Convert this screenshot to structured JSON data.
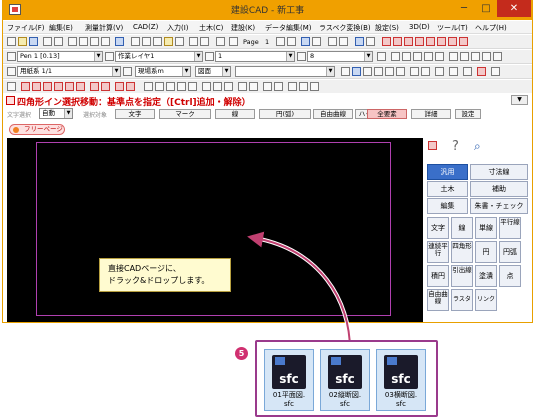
{
  "window": {
    "title": "建設CAD - 新工事",
    "min_label": "─",
    "max_label": "□",
    "close_label": "✕"
  },
  "menu": [
    "ファイル(F)",
    "編集(E)",
    "測量計算(V)",
    "CAD(Z)",
    "入力(I)",
    "土木(C)",
    "建設(K)",
    "データ編集(M)",
    "ラスベク変換(B)",
    "設定(S)",
    "3D(D)",
    "ツール(T)",
    "ヘルプ(H)"
  ],
  "toolbar1": {
    "page_label": "Page",
    "page_value": "1"
  },
  "toolbar2": {
    "pen_value": "Pen 1 [0.13]",
    "layer_value": "作業レイヤ1",
    "line_value": "1",
    "color_value": "8"
  },
  "toolbar3": {
    "paper_value": "用紙系 1/1",
    "coord_value": "現場系m",
    "view_value": "図面"
  },
  "command": {
    "text": "四角形イン選択移動：基準点を指定（[Ctrl]追加・解除）",
    "dropdown": "▼"
  },
  "options": {
    "label1": "文字選択",
    "auto_value": "自動",
    "label2": "選択対象",
    "buttons": [
      "文字",
      "マーク",
      "線",
      "円(弧)",
      "自由曲線",
      "ハッチング",
      "全要素",
      "詳細",
      "設定"
    ]
  },
  "page_tab": "フリーページ",
  "panel": {
    "row1": [
      "汎用",
      "寸法線"
    ],
    "row2": [
      "土木",
      "補助"
    ],
    "row3": [
      "編集",
      "朱書・チェック"
    ],
    "grid": [
      "文字",
      "線",
      "単線",
      "平行線",
      "連続平行",
      "四角形",
      "円",
      "円弧",
      "積円",
      "引出線",
      "塗潰",
      "点",
      "自由曲線",
      "ラスタ",
      "リンク"
    ]
  },
  "callout": {
    "line1": "直接CADページに、",
    "line2": "ドラック&ドロップします。"
  },
  "step": "5",
  "files": [
    {
      "ext": "sfc",
      "line1": "01平面図.",
      "line2": "sfc"
    },
    {
      "ext": "sfc",
      "line1": "02縦断図.",
      "line2": "sfc"
    },
    {
      "ext": "sfc",
      "line1": "03横断図.",
      "line2": "sfc"
    }
  ],
  "colors": {
    "titlebar": "#f0a000",
    "canvas": "#000000",
    "frame": "#b040b0",
    "command_text": "#d00000",
    "panel_selected": "#3a6fc9",
    "files_border": "#9a3a8c",
    "arrow": "#c04070"
  }
}
